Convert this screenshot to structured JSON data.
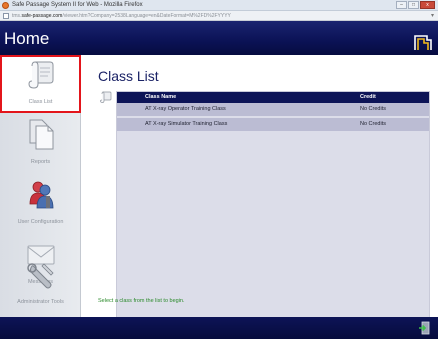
{
  "browser": {
    "window_title": "Safe Passage System II for Web - Mozilla Firefox",
    "url_prefix": "tms.",
    "url_domain": "safe-passage.com",
    "url_path": "/viewer.htm?Company=2538Language=en&DateFormat=M%2FD%2FYYYY",
    "controls": {
      "minimize": "–",
      "maximize": "□",
      "close": "x"
    }
  },
  "header": {
    "title": "Home",
    "logo_icon": "company-logo-icon"
  },
  "sidebar": {
    "items": [
      {
        "label": "Class List",
        "icon": "scroll-icon",
        "active": true
      },
      {
        "label": "Reports",
        "icon": "documents-icon",
        "active": false
      },
      {
        "label": "User Configuration",
        "icon": "users-icon",
        "active": false
      },
      {
        "label": "Messages",
        "icon": "envelope-icon",
        "active": false
      },
      {
        "label": "Administrator Tools",
        "icon": "wrench-icon",
        "active": false
      }
    ]
  },
  "main": {
    "title": "Class List",
    "table": {
      "columns": [
        "Class Name",
        "Credit"
      ],
      "rows": [
        {
          "name": "AT X-ray Operator Training Class",
          "credit": "No Credits"
        },
        {
          "name": "AT X-ray Simulator Training Class",
          "credit": "No Credits"
        }
      ]
    },
    "hint": "Select a class from the list to begin."
  },
  "colors": {
    "header_bg": "#0b1255",
    "table_header_bg": "#0d1457",
    "row_bg": "#bbbcd3",
    "active_outline": "#e3151b",
    "hint_text": "#2a8a2a"
  }
}
